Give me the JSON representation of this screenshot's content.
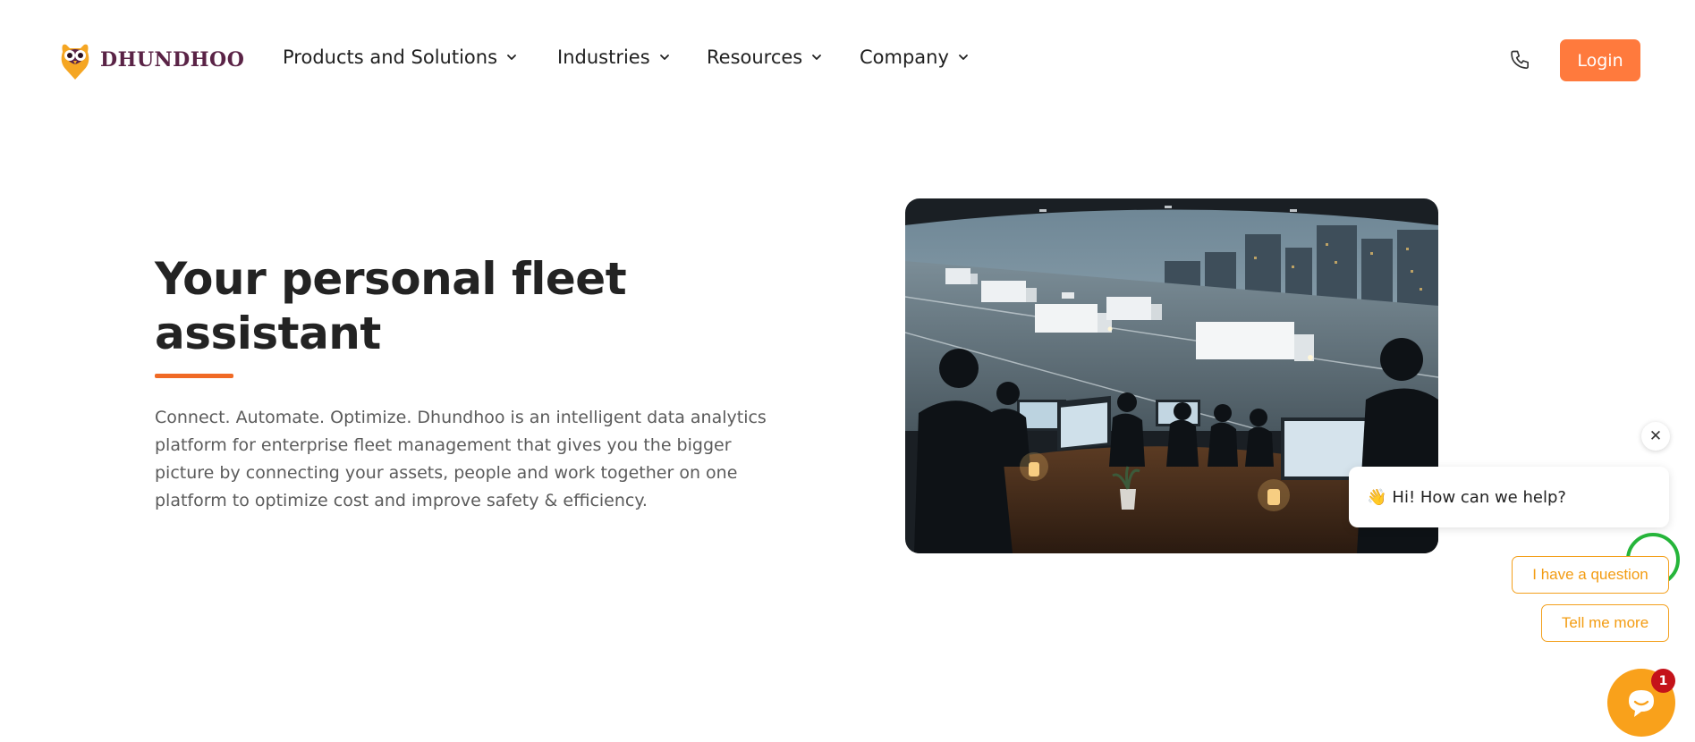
{
  "brand": {
    "name": "DHUNDHOO",
    "accent": "#ff7a3d",
    "brand_color": "#5a2346"
  },
  "nav": {
    "items": [
      {
        "label": "Products and Solutions",
        "icon": "chevron-down-icon"
      },
      {
        "label": "Industries",
        "icon": "chevron-down-icon"
      },
      {
        "label": "Resources",
        "icon": "chevron-down-icon"
      },
      {
        "label": "Company",
        "icon": "chevron-down-icon"
      }
    ],
    "phone_icon": "phone-icon",
    "login_label": "Login"
  },
  "hero": {
    "title_line1": "Your personal fleet",
    "title_line2": "assistant",
    "description": "Connect. Automate. Optimize. Dhundhoo is an intelligent data analytics platform for enterprise fleet management that gives you the bigger picture by connecting your assets, people and work together on one platform to optimize cost and improve safety & efficiency.",
    "underline_color": "#f06a25",
    "image": "fleet-control-room-image"
  },
  "chat": {
    "close_symbol": "✕",
    "greeting_emoji": "👋",
    "greeting": "Hi! How can we help?",
    "replies": [
      "I have a question",
      "Tell me more"
    ],
    "badge_count": "1",
    "accent": "#f9a11b",
    "whatsapp_color": "#25b53a"
  }
}
